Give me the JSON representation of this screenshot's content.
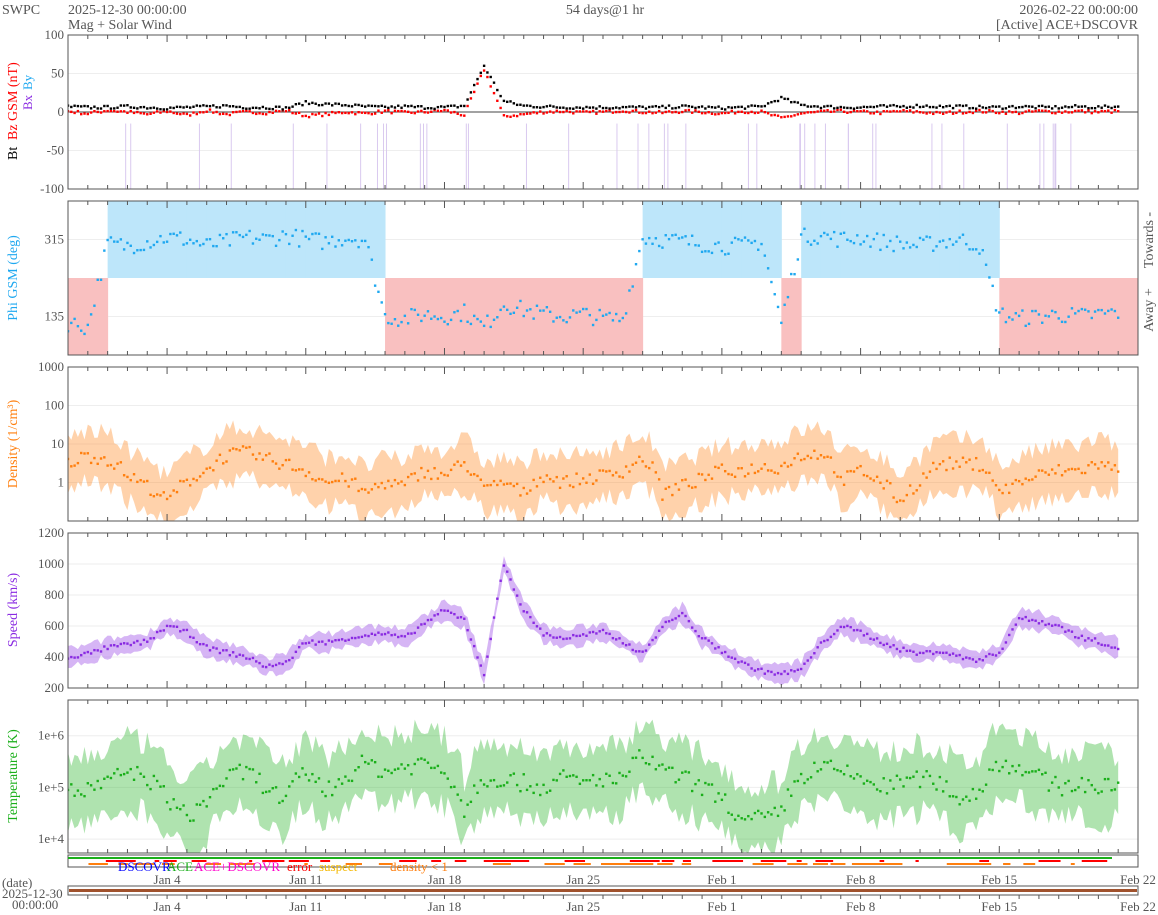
{
  "header": {
    "org": "SWPC",
    "start": "2025-12-30 00:00:00",
    "subtitle": "Mag + Solar Wind",
    "span": "54 days@1 hr",
    "end": "2026-02-22 00:00:00",
    "source": "[Active] ACE+DSCOVR"
  },
  "colors": {
    "bt": "#000000",
    "bz": "#ff0000",
    "phi": "#1fa8f0",
    "towards": "#bde6fa",
    "away": "#f9c0c0",
    "density": "#ff7f0e",
    "speed": "#8a2be2",
    "temp": "#1aaf1a"
  },
  "legend": {
    "dscovr": "DSCOVR",
    "ace": "ACE",
    "both": "ACE+DSCOVR",
    "error": "error",
    "suspect": "suspect",
    "density_low": "density < 1"
  },
  "date_axis": {
    "label": "(date)",
    "start_date": "2025-12-30",
    "start_time": "00:00:00",
    "ticks": [
      "Jan 4",
      "Jan 11",
      "Jan 18",
      "Jan 25",
      "Feb 1",
      "Feb 8",
      "Feb 15",
      "Feb 22"
    ]
  },
  "chart_data": [
    {
      "type": "line",
      "title": "Mag",
      "ylabel_bt": "Bt",
      "ylabel": "Bz GSM (nT)",
      "small_labels": [
        "Bx",
        "By"
      ],
      "ylim": [
        -100,
        100
      ],
      "ticks": [
        "100",
        "50",
        "0",
        "-50",
        "-100"
      ],
      "series": [
        {
          "name": "Bt",
          "values": [
            7,
            6,
            6,
            7,
            6,
            5,
            6,
            7,
            8,
            6,
            6,
            5,
            12,
            10,
            9,
            7,
            6,
            7,
            6,
            6,
            8,
            60,
            14,
            8,
            7,
            6,
            6,
            6,
            6,
            6,
            6,
            7,
            6,
            5,
            6,
            7,
            18,
            9,
            7,
            6,
            6,
            7,
            7,
            8,
            7,
            7,
            6,
            6,
            7,
            6,
            6,
            7,
            6,
            7
          ]
        },
        {
          "name": "Bz",
          "values": [
            1,
            -2,
            2,
            0,
            -3,
            1,
            -4,
            2,
            -3,
            0,
            -1,
            2,
            -5,
            -3,
            0,
            -2,
            1,
            -1,
            0,
            2,
            -4,
            55,
            -6,
            -3,
            0,
            1,
            -1,
            0,
            2,
            0,
            -1,
            1,
            0,
            -2,
            1,
            0,
            -8,
            -2,
            0,
            1,
            0,
            -1,
            1,
            0,
            -2,
            0,
            1,
            0,
            -1,
            1,
            0,
            1,
            0,
            1
          ]
        }
      ]
    },
    {
      "type": "scatter",
      "ylabel": "Phi GSM (deg)",
      "right_labels": [
        "Towards -",
        "Away +"
      ],
      "ylim": [
        45,
        405
      ],
      "ticks": [
        "315",
        "135"
      ],
      "values": [
        120,
        110,
        305,
        300,
        310,
        320,
        315,
        300,
        310,
        320,
        315,
        325,
        315,
        310,
        320,
        315,
        135,
        130,
        140,
        135,
        145,
        110,
        165,
        150,
        140,
        135,
        140,
        130,
        130,
        320,
        315,
        310,
        305,
        300,
        300,
        310,
        120,
        320,
        325,
        315,
        320,
        310,
        305,
        300,
        310,
        315,
        300,
        140,
        130,
        135,
        140,
        135,
        140,
        145
      ]
    },
    {
      "type": "scatter",
      "ylabel": "Density (1/cm³)",
      "scale": "log",
      "ylim": [
        0.1,
        1000
      ],
      "ticks": [
        "1000",
        "100",
        "10",
        "1"
      ],
      "values": [
        3,
        5,
        4,
        1.5,
        0.8,
        0.3,
        1,
        2,
        5,
        6,
        4,
        3,
        2,
        1,
        1.2,
        0.5,
        1,
        0.8,
        2,
        1.5,
        3,
        0.6,
        1,
        0.5,
        1.5,
        1,
        1.2,
        1.5,
        2,
        4,
        0.5,
        0.8,
        1.2,
        2,
        2,
        2.5,
        2.5,
        5,
        6,
        1,
        2,
        1,
        0.3,
        1,
        3,
        3,
        3,
        0.5,
        1,
        1.5,
        2,
        2,
        3,
        2
      ]
    },
    {
      "type": "scatter",
      "ylabel": "Speed (km/s)",
      "ylim": [
        200,
        1200
      ],
      "ticks": [
        "1200",
        "1000",
        "800",
        "600",
        "400",
        "200"
      ],
      "values": [
        400,
        420,
        460,
        480,
        500,
        600,
        560,
        460,
        430,
        400,
        340,
        360,
        500,
        490,
        520,
        540,
        550,
        520,
        620,
        700,
        640,
        290,
        1000,
        700,
        550,
        520,
        540,
        560,
        500,
        420,
        600,
        680,
        520,
        440,
        360,
        310,
        290,
        320,
        480,
        600,
        560,
        500,
        450,
        420,
        440,
        400,
        380,
        430,
        650,
        630,
        600,
        530,
        500,
        460
      ]
    },
    {
      "type": "scatter",
      "ylabel": "Temperature (K)",
      "scale": "log",
      "ylim": [
        5400,
        4900000
      ],
      "ticks": [
        "1e+6",
        "1e+5",
        "1e+4"
      ],
      "values": [
        80000,
        90000,
        120000,
        200000,
        150000,
        60000,
        25000,
        50000,
        150000,
        200000,
        100000,
        50000,
        200000,
        80000,
        150000,
        300000,
        200000,
        250000,
        300000,
        200000,
        30000,
        150000,
        150000,
        120000,
        100000,
        150000,
        120000,
        150000,
        130000,
        400000,
        200000,
        150000,
        100000,
        60000,
        20000,
        25000,
        30000,
        150000,
        250000,
        200000,
        150000,
        100000,
        120000,
        150000,
        120000,
        60000,
        80000,
        300000,
        250000,
        150000,
        100000,
        120000,
        100000,
        100000
      ]
    }
  ]
}
